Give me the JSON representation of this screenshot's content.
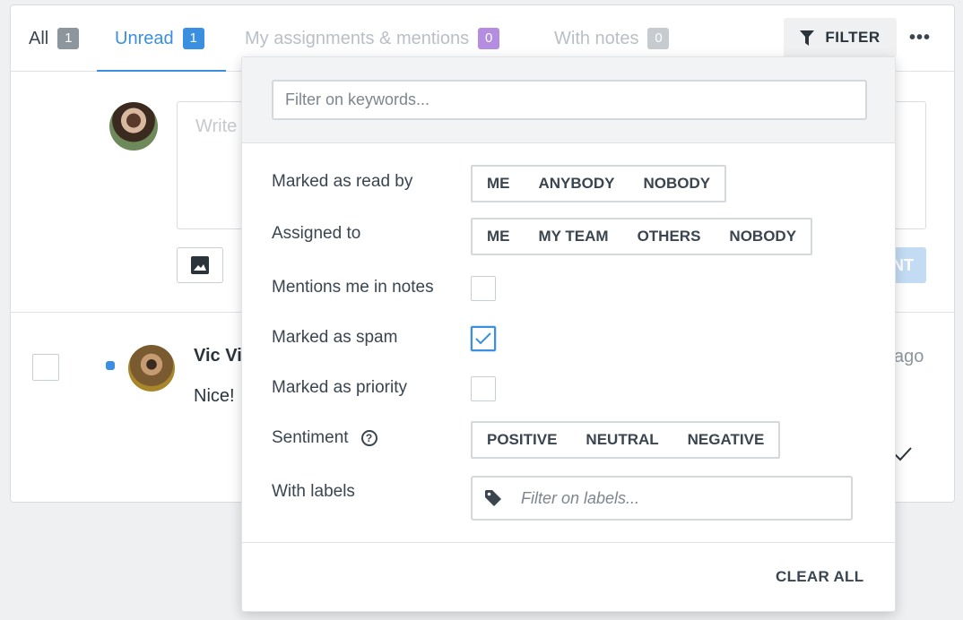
{
  "tabs": [
    {
      "label": "All",
      "count": "1"
    },
    {
      "label": "Unread",
      "count": "1"
    },
    {
      "label": "My assignments & mentions",
      "count": "0"
    },
    {
      "label": "With notes",
      "count": "0"
    }
  ],
  "toolbar": {
    "filter_label": "FILTER",
    "more_icon": "ellipsis-icon"
  },
  "composer": {
    "placeholder": "Write",
    "send_label": "NT"
  },
  "message": {
    "sender": "Vic Vi",
    "preview": "Nice!",
    "time": "ago"
  },
  "filter": {
    "keyword_placeholder": "Filter on keywords...",
    "read_by": {
      "label": "Marked as read by",
      "options": [
        "ME",
        "ANYBODY",
        "NOBODY"
      ]
    },
    "assigned_to": {
      "label": "Assigned to",
      "options": [
        "ME",
        "MY TEAM",
        "OTHERS",
        "NOBODY"
      ]
    },
    "mentions": {
      "label": "Mentions me in notes",
      "checked": false
    },
    "spam": {
      "label": "Marked as spam",
      "checked": true
    },
    "priority": {
      "label": "Marked as priority",
      "checked": false
    },
    "sentiment": {
      "label": "Sentiment",
      "options": [
        "POSITIVE",
        "NEUTRAL",
        "NEGATIVE"
      ]
    },
    "labels": {
      "label": "With labels",
      "placeholder": "Filter on labels..."
    },
    "clear_label": "CLEAR ALL"
  },
  "colors": {
    "accent": "#3a8fe0",
    "mentions_badge": "#b48de0"
  }
}
